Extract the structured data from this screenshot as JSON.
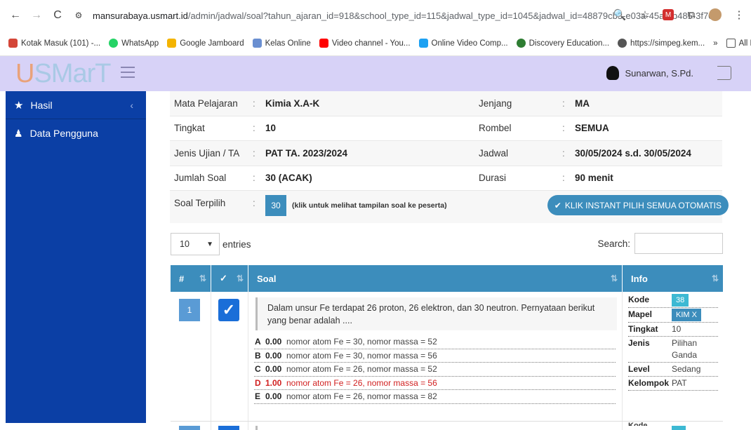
{
  "browser": {
    "url_host": "mansurabaya.usmart.id",
    "url_path": "/admin/jadwal/soal?tahun_ajaran_id=918&school_type_id=115&jadwal_type_id=1045&jadwal_id=48879cb3-e03a-45a2-b485-3f70..."
  },
  "bookmarks": [
    {
      "label": "Kotak Masuk (101) -...",
      "icon": "gmail-icon",
      "color": "#d44638"
    },
    {
      "label": "WhatsApp",
      "icon": "whatsapp-icon",
      "color": "#25d366"
    },
    {
      "label": "Google Jamboard",
      "icon": "jamboard-icon",
      "color": "#f4b400"
    },
    {
      "label": "Kelas Online",
      "icon": "school-icon",
      "color": "#6a8fd1"
    },
    {
      "label": "Video channel - You...",
      "icon": "youtube-icon",
      "color": "#ff0000"
    },
    {
      "label": "Online Video Comp...",
      "icon": "play-icon",
      "color": "#1da1f2"
    },
    {
      "label": "Discovery Education...",
      "icon": "globe-icon",
      "color": "#2e7d32"
    },
    {
      "label": "https://simpeg.kem...",
      "icon": "web-icon",
      "color": "#555555"
    }
  ],
  "bookmarks_more": "»",
  "all_bookmarks": "All Bookmarks",
  "app": {
    "logo": "USMarT",
    "user_name": "Sunarwan, S.Pd."
  },
  "sidebar": {
    "items": [
      {
        "label": "Hasil",
        "icon": "star-icon"
      },
      {
        "label": "Data Pengguna",
        "icon": "users-icon"
      }
    ]
  },
  "info": {
    "rows": [
      {
        "l1": "Mata Pelajaran",
        "v1": "Kimia X.A-K",
        "l2": "Jenjang",
        "v2": "MA"
      },
      {
        "l1": "Tingkat",
        "v1": "10",
        "l2": "Rombel",
        "v2": "SEMUA"
      },
      {
        "l1": "Jenis Ujian / TA",
        "v1": "PAT TA. 2023/2024",
        "l2": "Jadwal",
        "v2": "30/05/2024 s.d. 30/05/2024"
      },
      {
        "l1": "Jumlah Soal",
        "v1": "30 (ACAK)",
        "l2": "Durasi",
        "v2": "90 menit"
      }
    ],
    "sep": ":",
    "terpilih_label": "Soal Terpilih",
    "terpilih_value": "30",
    "terpilih_note": "(klik untuk melihat tampilan soal ke peserta)",
    "auto_button": "KLIK INSTANT PILIH SEMUA OTOMATIS"
  },
  "table_controls": {
    "entries_value": "10",
    "entries_label": "entries",
    "search_label": "Search:"
  },
  "grid": {
    "headers": [
      "#",
      "✓",
      "Soal",
      "Info"
    ],
    "rows": [
      {
        "num": "1",
        "question": "Dalam unsur Fe terdapat 26 proton, 26 elektron, dan 30 neutron. Pernyataan berikut yang benar adalah ....",
        "options": [
          {
            "key": "A",
            "score": "0.00",
            "text": "nomor atom Fe = 30, nomor massa = 52"
          },
          {
            "key": "B",
            "score": "0.00",
            "text": "nomor atom Fe = 30, nomor massa = 56"
          },
          {
            "key": "C",
            "score": "0.00",
            "text": "nomor atom Fe = 26, nomor massa = 52"
          },
          {
            "key": "D",
            "score": "1.00",
            "text": "nomor atom Fe = 26, nomor massa = 56"
          },
          {
            "key": "E",
            "score": "0.00",
            "text": "nomor atom Fe = 26, nomor massa = 82"
          }
        ],
        "meta": [
          {
            "k": "Kode",
            "v": "38"
          },
          {
            "k": "Mapel",
            "v": "KIM X"
          },
          {
            "k": "Tingkat",
            "v": "10"
          },
          {
            "k": "Jenis",
            "v": "Pilihan Ganda"
          },
          {
            "k": "Level",
            "v": "Sedang"
          },
          {
            "k": "Kelompok",
            "v": "PAT"
          }
        ]
      }
    ],
    "next_row_meta_label": "Kode"
  }
}
